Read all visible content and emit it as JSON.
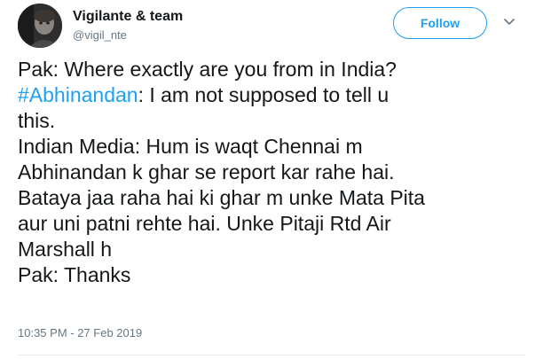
{
  "author": {
    "display_name": "Vigilante & team",
    "handle": "@vigil_nte"
  },
  "follow_button": {
    "label": "Follow"
  },
  "tweet": {
    "line1": "Pak: Where exactly are you from in India?",
    "hashtag": "#Abhinandan",
    "line2_rest": ": I am not supposed to tell u",
    "line3": "this.",
    "line4": "Indian Media: Hum is waqt Chennai m",
    "line5": "Abhinandan k ghar se report kar rahe hai.",
    "line6": "Bataya jaa raha hai ki ghar m unke Mata Pita",
    "line7": "aur uni patni rehte hai. Unke Pitaji Rtd Air",
    "line8": "Marshall h",
    "line9": "Pak: Thanks"
  },
  "timestamp": "10:35 PM - 27 Feb 2019",
  "colors": {
    "accent": "#1da1f2",
    "text": "#14171a",
    "muted": "#657786"
  },
  "icons": {
    "caret": "chevron-down-icon"
  }
}
